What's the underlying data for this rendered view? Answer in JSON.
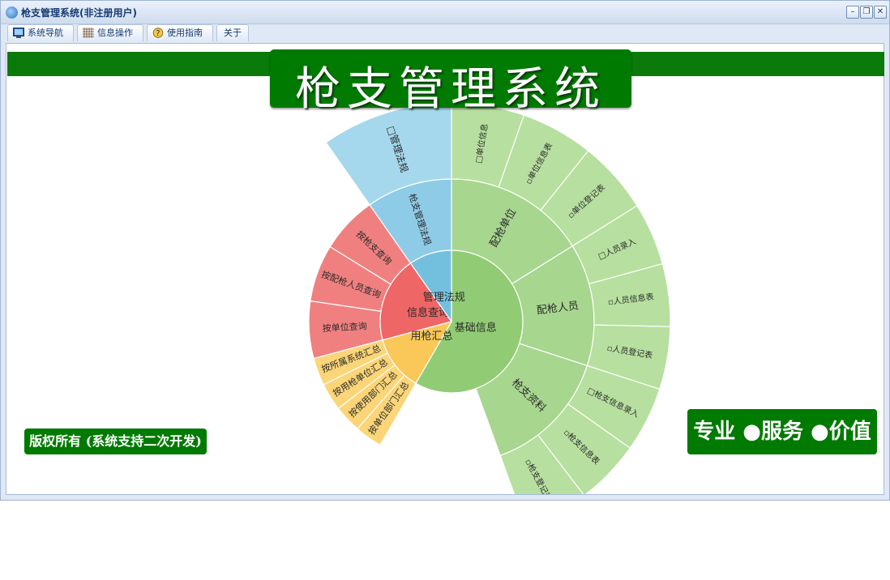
{
  "window": {
    "title": "枪支管理系统(非注册用户)",
    "controls": [
      "–",
      "❐",
      "✕"
    ]
  },
  "tabs": [
    {
      "label": "系统导航",
      "icon": "monitor-icon"
    },
    {
      "label": "信息操作",
      "icon": "grid-icon"
    },
    {
      "label": "使用指南",
      "icon": "help-icon"
    },
    {
      "label": "关于",
      "icon": ""
    }
  ],
  "main": {
    "banner_title": "枪支管理系统",
    "copyright": "版权所有 (系统支持二次开发)",
    "slogan": "专业 ●服务 ●价值"
  },
  "sunburst": {
    "center": "基础信息",
    "groups": [
      {
        "label": "信息查询",
        "color": "#ee6666",
        "leaves": [
          "按单位查询",
          "按配枪人员查询",
          "按枪支查询"
        ]
      },
      {
        "label": "管理法规",
        "color": "#73c0de",
        "leaves": [
          "枪支管理法规"
        ],
        "outer": [
          "□管理法规"
        ]
      },
      {
        "label": "用枪汇总",
        "color": "#fac858",
        "leaves": [
          "按单位部门汇总",
          "按使用部门汇总",
          "按用枪单位汇总",
          "按所属系统汇总"
        ]
      }
    ],
    "basic": {
      "color": "#91cc75",
      "children": [
        {
          "label": "配枪单位",
          "leaves": [
            "□单位信息",
            "▫单位信息表",
            "▫单位登记表"
          ]
        },
        {
          "label": "配枪人员",
          "leaves": [
            "□人员录入",
            "▫人员信息表",
            "▫人员登记表"
          ]
        },
        {
          "label": "枪支资料",
          "leaves": [
            "□枪支信息录入",
            "▫枪支信息表",
            "▫枪支登记表"
          ]
        }
      ]
    }
  }
}
